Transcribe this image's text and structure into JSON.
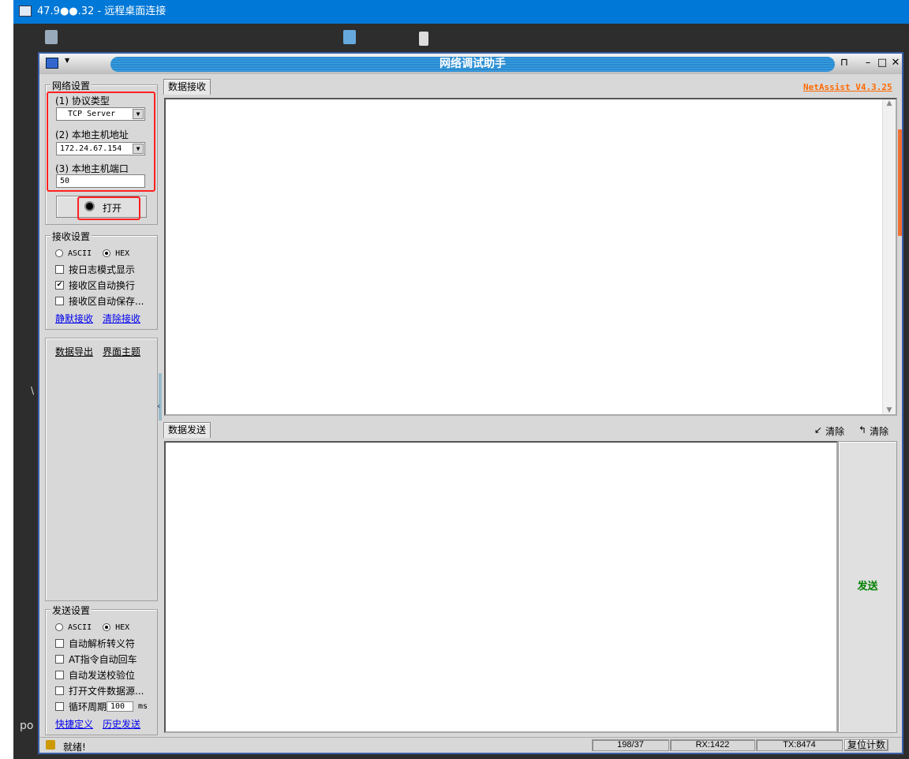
{
  "rdp": {
    "title": "47.9●●.32 - 远程桌面连接"
  },
  "desktop": {
    "left_text_1": "\\",
    "left_text_2": "po"
  },
  "app": {
    "title": "网络调试助手",
    "version": "NetAssist V4.3.25"
  },
  "network": {
    "title": "网络设置",
    "protocol_label": "(1) 协议类型",
    "protocol_value": "TCP Server",
    "host_label": "(2) 本地主机地址",
    "host_value": "172.24.67.154",
    "port_label": "(3) 本地主机端口",
    "port_value": "50",
    "open_button": "打开"
  },
  "receive": {
    "title": "接收设置",
    "ascii": "ASCII",
    "hex": "HEX",
    "options": [
      "按日志模式显示",
      "接收区自动换行",
      "接收区自动保存..."
    ],
    "checked": [
      false,
      true,
      false
    ],
    "link_silent": "静默接收",
    "link_clear": "清除接收"
  },
  "extra": {
    "export": "数据导出",
    "theme": "界面主题"
  },
  "send": {
    "title": "发送设置",
    "ascii": "ASCII",
    "hex": "HEX",
    "options": [
      "自动解析转义符",
      "AT指令自动回车",
      "自动发送校验位",
      "打开文件数据源..."
    ],
    "loop_label": "循环周期",
    "loop_value": "100",
    "loop_unit": "ms",
    "link_shortcut": "快捷定义",
    "link_history": "历史发送"
  },
  "tabs": {
    "receive": "数据接收",
    "send": "数据发送"
  },
  "send_area": {
    "clear1": "清除",
    "clear2": "清除",
    "send_button": "发送",
    "value": ""
  },
  "status": {
    "text": "就绪!",
    "counter": "198/37",
    "rx": "RX:1422",
    "tx": "TX:8474",
    "reset": "复位计数"
  }
}
